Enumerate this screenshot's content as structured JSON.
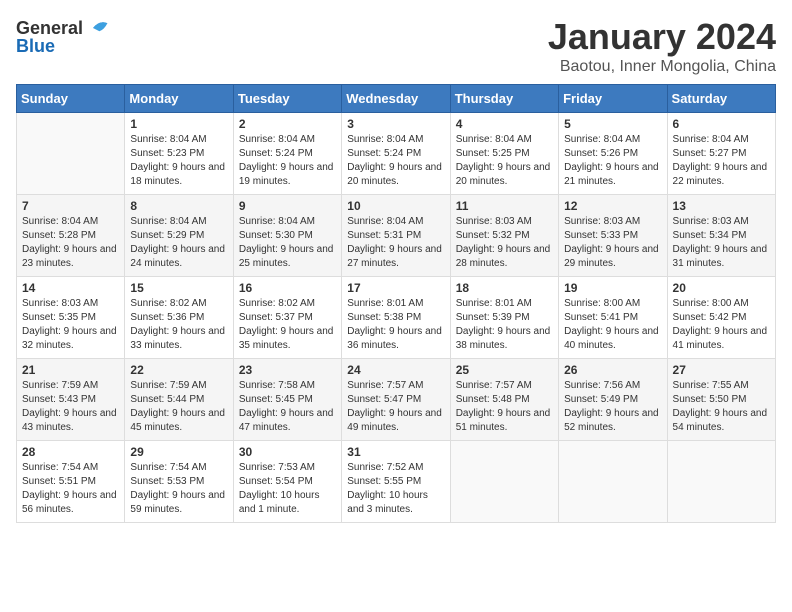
{
  "header": {
    "logo_general": "General",
    "logo_blue": "Blue",
    "title": "January 2024",
    "subtitle": "Baotou, Inner Mongolia, China"
  },
  "days_of_week": [
    "Sunday",
    "Monday",
    "Tuesday",
    "Wednesday",
    "Thursday",
    "Friday",
    "Saturday"
  ],
  "weeks": [
    [
      {
        "day": "",
        "sunrise": "",
        "sunset": "",
        "daylight": ""
      },
      {
        "day": "1",
        "sunrise": "Sunrise: 8:04 AM",
        "sunset": "Sunset: 5:23 PM",
        "daylight": "Daylight: 9 hours and 18 minutes."
      },
      {
        "day": "2",
        "sunrise": "Sunrise: 8:04 AM",
        "sunset": "Sunset: 5:24 PM",
        "daylight": "Daylight: 9 hours and 19 minutes."
      },
      {
        "day": "3",
        "sunrise": "Sunrise: 8:04 AM",
        "sunset": "Sunset: 5:24 PM",
        "daylight": "Daylight: 9 hours and 20 minutes."
      },
      {
        "day": "4",
        "sunrise": "Sunrise: 8:04 AM",
        "sunset": "Sunset: 5:25 PM",
        "daylight": "Daylight: 9 hours and 20 minutes."
      },
      {
        "day": "5",
        "sunrise": "Sunrise: 8:04 AM",
        "sunset": "Sunset: 5:26 PM",
        "daylight": "Daylight: 9 hours and 21 minutes."
      },
      {
        "day": "6",
        "sunrise": "Sunrise: 8:04 AM",
        "sunset": "Sunset: 5:27 PM",
        "daylight": "Daylight: 9 hours and 22 minutes."
      }
    ],
    [
      {
        "day": "7",
        "sunrise": "Sunrise: 8:04 AM",
        "sunset": "Sunset: 5:28 PM",
        "daylight": "Daylight: 9 hours and 23 minutes."
      },
      {
        "day": "8",
        "sunrise": "Sunrise: 8:04 AM",
        "sunset": "Sunset: 5:29 PM",
        "daylight": "Daylight: 9 hours and 24 minutes."
      },
      {
        "day": "9",
        "sunrise": "Sunrise: 8:04 AM",
        "sunset": "Sunset: 5:30 PM",
        "daylight": "Daylight: 9 hours and 25 minutes."
      },
      {
        "day": "10",
        "sunrise": "Sunrise: 8:04 AM",
        "sunset": "Sunset: 5:31 PM",
        "daylight": "Daylight: 9 hours and 27 minutes."
      },
      {
        "day": "11",
        "sunrise": "Sunrise: 8:03 AM",
        "sunset": "Sunset: 5:32 PM",
        "daylight": "Daylight: 9 hours and 28 minutes."
      },
      {
        "day": "12",
        "sunrise": "Sunrise: 8:03 AM",
        "sunset": "Sunset: 5:33 PM",
        "daylight": "Daylight: 9 hours and 29 minutes."
      },
      {
        "day": "13",
        "sunrise": "Sunrise: 8:03 AM",
        "sunset": "Sunset: 5:34 PM",
        "daylight": "Daylight: 9 hours and 31 minutes."
      }
    ],
    [
      {
        "day": "14",
        "sunrise": "Sunrise: 8:03 AM",
        "sunset": "Sunset: 5:35 PM",
        "daylight": "Daylight: 9 hours and 32 minutes."
      },
      {
        "day": "15",
        "sunrise": "Sunrise: 8:02 AM",
        "sunset": "Sunset: 5:36 PM",
        "daylight": "Daylight: 9 hours and 33 minutes."
      },
      {
        "day": "16",
        "sunrise": "Sunrise: 8:02 AM",
        "sunset": "Sunset: 5:37 PM",
        "daylight": "Daylight: 9 hours and 35 minutes."
      },
      {
        "day": "17",
        "sunrise": "Sunrise: 8:01 AM",
        "sunset": "Sunset: 5:38 PM",
        "daylight": "Daylight: 9 hours and 36 minutes."
      },
      {
        "day": "18",
        "sunrise": "Sunrise: 8:01 AM",
        "sunset": "Sunset: 5:39 PM",
        "daylight": "Daylight: 9 hours and 38 minutes."
      },
      {
        "day": "19",
        "sunrise": "Sunrise: 8:00 AM",
        "sunset": "Sunset: 5:41 PM",
        "daylight": "Daylight: 9 hours and 40 minutes."
      },
      {
        "day": "20",
        "sunrise": "Sunrise: 8:00 AM",
        "sunset": "Sunset: 5:42 PM",
        "daylight": "Daylight: 9 hours and 41 minutes."
      }
    ],
    [
      {
        "day": "21",
        "sunrise": "Sunrise: 7:59 AM",
        "sunset": "Sunset: 5:43 PM",
        "daylight": "Daylight: 9 hours and 43 minutes."
      },
      {
        "day": "22",
        "sunrise": "Sunrise: 7:59 AM",
        "sunset": "Sunset: 5:44 PM",
        "daylight": "Daylight: 9 hours and 45 minutes."
      },
      {
        "day": "23",
        "sunrise": "Sunrise: 7:58 AM",
        "sunset": "Sunset: 5:45 PM",
        "daylight": "Daylight: 9 hours and 47 minutes."
      },
      {
        "day": "24",
        "sunrise": "Sunrise: 7:57 AM",
        "sunset": "Sunset: 5:47 PM",
        "daylight": "Daylight: 9 hours and 49 minutes."
      },
      {
        "day": "25",
        "sunrise": "Sunrise: 7:57 AM",
        "sunset": "Sunset: 5:48 PM",
        "daylight": "Daylight: 9 hours and 51 minutes."
      },
      {
        "day": "26",
        "sunrise": "Sunrise: 7:56 AM",
        "sunset": "Sunset: 5:49 PM",
        "daylight": "Daylight: 9 hours and 52 minutes."
      },
      {
        "day": "27",
        "sunrise": "Sunrise: 7:55 AM",
        "sunset": "Sunset: 5:50 PM",
        "daylight": "Daylight: 9 hours and 54 minutes."
      }
    ],
    [
      {
        "day": "28",
        "sunrise": "Sunrise: 7:54 AM",
        "sunset": "Sunset: 5:51 PM",
        "daylight": "Daylight: 9 hours and 56 minutes."
      },
      {
        "day": "29",
        "sunrise": "Sunrise: 7:54 AM",
        "sunset": "Sunset: 5:53 PM",
        "daylight": "Daylight: 9 hours and 59 minutes."
      },
      {
        "day": "30",
        "sunrise": "Sunrise: 7:53 AM",
        "sunset": "Sunset: 5:54 PM",
        "daylight": "Daylight: 10 hours and 1 minute."
      },
      {
        "day": "31",
        "sunrise": "Sunrise: 7:52 AM",
        "sunset": "Sunset: 5:55 PM",
        "daylight": "Daylight: 10 hours and 3 minutes."
      },
      {
        "day": "",
        "sunrise": "",
        "sunset": "",
        "daylight": ""
      },
      {
        "day": "",
        "sunrise": "",
        "sunset": "",
        "daylight": ""
      },
      {
        "day": "",
        "sunrise": "",
        "sunset": "",
        "daylight": ""
      }
    ]
  ]
}
